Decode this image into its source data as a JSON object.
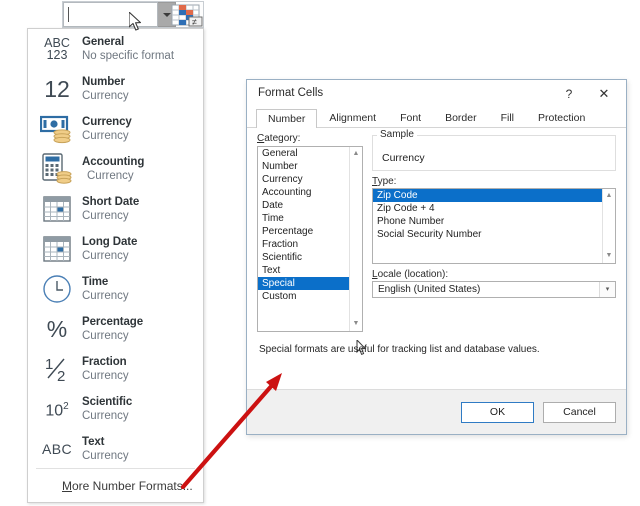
{
  "toolbar": {
    "number_format_combo": {
      "name": "number-format-combo",
      "value": "",
      "placeholder": ""
    },
    "dropdown_arrow_label": "▾",
    "table_style_icon": "format-as-table-icon"
  },
  "dropdown": {
    "items": [
      {
        "icon": "abc123-glyph",
        "icon_text_top": "ABC",
        "icon_text_bottom": "123",
        "title": "General",
        "subtitle": "No specific format"
      },
      {
        "icon": "number-12-glyph",
        "icon_text": "12",
        "title": "Number",
        "subtitle": "Currency"
      },
      {
        "icon": "currency-banknote-icon",
        "title": "Currency",
        "subtitle": "Currency"
      },
      {
        "icon": "accounting-calculator-icon",
        "title": "Accounting",
        "subtitle": "Currency"
      },
      {
        "icon": "short-date-calendar-icon",
        "title": "Short Date",
        "subtitle": "Currency"
      },
      {
        "icon": "long-date-calendar-icon",
        "title": "Long Date",
        "subtitle": "Currency"
      },
      {
        "icon": "clock-icon",
        "title": "Time",
        "subtitle": "Currency"
      },
      {
        "icon": "percent-glyph",
        "icon_text": "%",
        "title": "Percentage",
        "subtitle": "Currency"
      },
      {
        "icon": "fraction-glyph",
        "icon_text": "1/2",
        "title": "Fraction",
        "subtitle": "Currency"
      },
      {
        "icon": "scientific-glyph",
        "icon_text": "10",
        "icon_text_sup": "2",
        "title": "Scientific",
        "subtitle": "Currency"
      },
      {
        "icon": "abc-glyph",
        "icon_text": "ABC",
        "title": "Text",
        "subtitle": "Currency"
      }
    ],
    "more_formats": {
      "accel": "M",
      "rest": "ore Number Formats..."
    }
  },
  "dialog": {
    "title": "Format Cells",
    "help_icon": "question-mark-icon",
    "close_icon": "close-x-icon",
    "tabs": [
      {
        "label": "Number",
        "active": true
      },
      {
        "label": "Alignment",
        "active": false
      },
      {
        "label": "Font",
        "active": false
      },
      {
        "label": "Border",
        "active": false
      },
      {
        "label": "Fill",
        "active": false
      },
      {
        "label": "Protection",
        "active": false
      }
    ],
    "category": {
      "label_accel": "C",
      "label_rest": "ategory:",
      "items": [
        {
          "label": "General",
          "selected": false
        },
        {
          "label": "Number",
          "selected": false
        },
        {
          "label": "Currency",
          "selected": false
        },
        {
          "label": "Accounting",
          "selected": false
        },
        {
          "label": "Date",
          "selected": false
        },
        {
          "label": "Time",
          "selected": false
        },
        {
          "label": "Percentage",
          "selected": false
        },
        {
          "label": "Fraction",
          "selected": false
        },
        {
          "label": "Scientific",
          "selected": false
        },
        {
          "label": "Text",
          "selected": false
        },
        {
          "label": "Special",
          "selected": true
        },
        {
          "label": "Custom",
          "selected": false
        }
      ]
    },
    "sample": {
      "legend": "Sample",
      "value": "Currency"
    },
    "type": {
      "label_accel": "T",
      "label_rest": "ype:",
      "items": [
        {
          "label": "Zip Code",
          "selected": true
        },
        {
          "label": "Zip Code + 4",
          "selected": false
        },
        {
          "label": "Phone Number",
          "selected": false
        },
        {
          "label": "Social Security Number",
          "selected": false
        }
      ]
    },
    "locale": {
      "label_accel": "L",
      "label_rest": "ocale (location):",
      "value": "English (United States)",
      "arrow": "▾"
    },
    "description": "Special formats are useful for tracking list and database values.",
    "buttons": {
      "ok": "OK",
      "cancel": "Cancel"
    }
  },
  "annotation": {
    "arrow_color": "#cc1111",
    "name": "red-pointer-arrow"
  },
  "colors": {
    "selection_blue": "#0b6fc9",
    "dialog_border": "#9ab0c4",
    "accent_icon_blue": "#2e6da4",
    "annotation_red": "#cc1111"
  }
}
